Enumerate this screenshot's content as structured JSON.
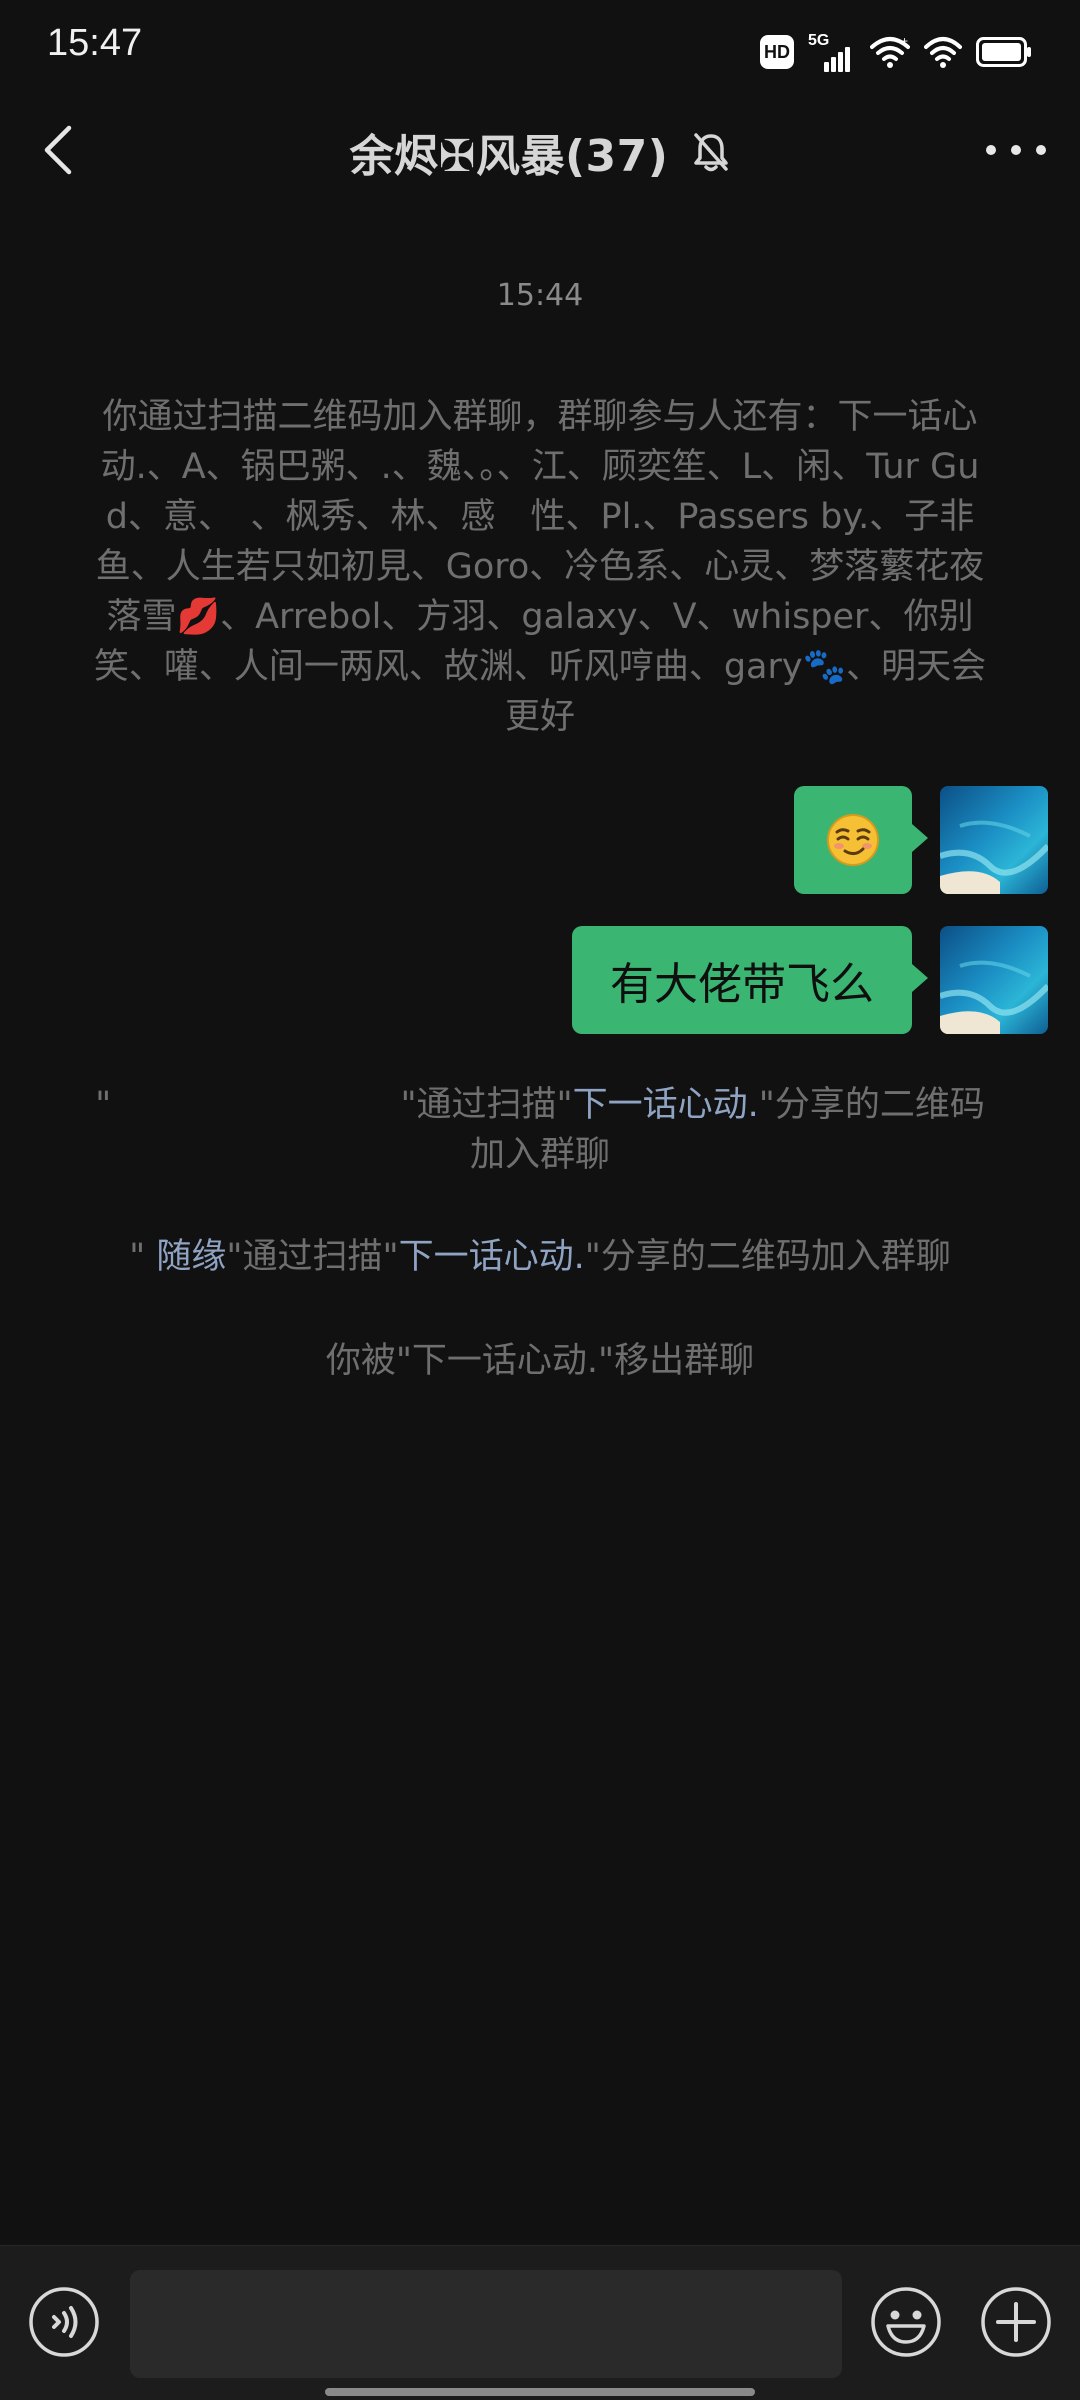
{
  "status_bar": {
    "time": "15:47",
    "hd_label": "HD",
    "network_label": "5G",
    "icons": [
      "hd-icon",
      "5g-signal-icon",
      "wifi-plus-icon",
      "wifi-icon",
      "battery-icon"
    ]
  },
  "header": {
    "title": "余烬✠风暴(37)",
    "icons": [
      "back-arrow-icon",
      "mute-bell-icon",
      "more-dots-icon"
    ]
  },
  "chat": {
    "timestamp": "15:44",
    "join_message": "你通过扫描二维码加入群聊，群聊参与人还有：下一话心动.、A、锅巴粥、.、魏、。、江、顾奕笙、L、闲、Tur Gud、意、　、枫秀、林、感　性、Pl.、Passers by.、子非鱼、人生若只如初見、Goro、冷色系、心灵、梦落蘩花夜落雪💋、Arrebol、方羽、galaxy、V、whisper、你别笑、嚾、人间一两风、故渊、听风哼曲、gary🐾、明天会更好",
    "messages": [
      {
        "type": "emoji",
        "icon": "smirk-emoji-icon",
        "sender": "self"
      },
      {
        "type": "text",
        "text": "有大佬带飞么",
        "sender": "self"
      }
    ],
    "scan_message_1": {
      "prefix": "\"                          \"通过扫描\"",
      "link": "下一话心动.",
      "suffix": "\"分享的二维码加入群聊"
    },
    "scan_message_2": {
      "prefix": "\" ",
      "name": "随缘",
      "middle": "\"通过扫描\"",
      "link": "下一话心动.",
      "suffix": "\"分享的二维码加入群聊"
    },
    "removed_message": "你被\"下一话心动.\"移出群聊"
  },
  "input_bar": {
    "placeholder": "",
    "icons": [
      "voice-icon",
      "emoji-icon",
      "plus-icon"
    ]
  },
  "colors": {
    "background": "#111111",
    "bubble": "#3bb572",
    "link": "#8fa3c2",
    "system_text": "#6f6f6f"
  }
}
